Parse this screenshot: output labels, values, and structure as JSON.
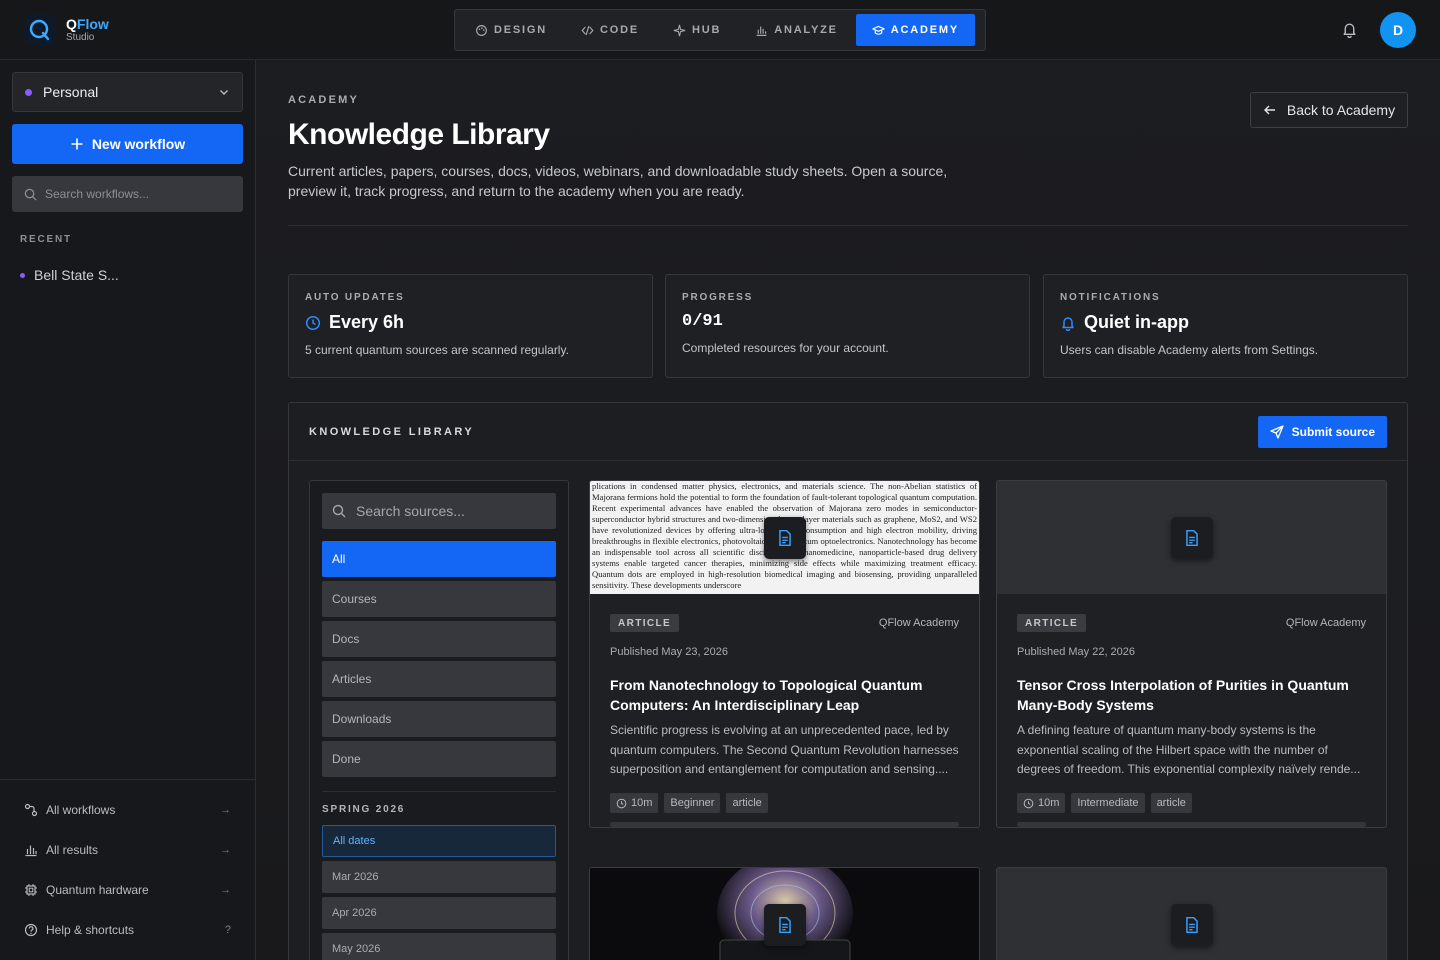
{
  "app": {
    "name_prefix": "Q",
    "name_accent": "Flow",
    "subtitle": "Studio"
  },
  "nav": {
    "tabs": [
      {
        "label": "DESIGN",
        "icon": "palette-icon",
        "active": false
      },
      {
        "label": "CODE",
        "icon": "code-icon",
        "active": false
      },
      {
        "label": "HUB",
        "icon": "hub-icon",
        "active": false
      },
      {
        "label": "ANALYZE",
        "icon": "bar-chart-icon",
        "active": false
      },
      {
        "label": "ACADEMY",
        "icon": "graduation-cap-icon",
        "active": true
      }
    ]
  },
  "user": {
    "initial": "D"
  },
  "sidebar": {
    "workspace": "Personal",
    "new_workflow": "New workflow",
    "search_placeholder": "Search workflows...",
    "recent_label": "RECENT",
    "recent": [
      "Bell State S..."
    ],
    "footer": [
      {
        "label": "All workflows",
        "icon": "workflow-icon",
        "hint": "→"
      },
      {
        "label": "All results",
        "icon": "bar-chart-icon",
        "hint": "→"
      },
      {
        "label": "Quantum hardware",
        "icon": "chip-icon",
        "hint": "→"
      },
      {
        "label": "Help & shortcuts",
        "icon": "help-icon",
        "hint": "?"
      }
    ]
  },
  "header": {
    "eyebrow": "ACADEMY",
    "title": "Knowledge Library",
    "description": "Current articles, papers, courses, docs, videos, webinars, and downloadable study sheets. Open a source, preview it, track progress, and return to the academy when you are ready.",
    "back_button": "Back to Academy"
  },
  "stats": [
    {
      "label": "AUTO UPDATES",
      "value": "Every 6h",
      "icon": "clock-icon",
      "sub": "5 current quantum sources are scanned regularly."
    },
    {
      "label": "PROGRESS",
      "value": "0/91",
      "icon": "",
      "sub": "Completed resources for your account."
    },
    {
      "label": "NOTIFICATIONS",
      "value": "Quiet in-app",
      "icon": "bell-icon",
      "sub": "Users can disable Academy alerts from Settings."
    }
  ],
  "library": {
    "label": "KNOWLEDGE LIBRARY",
    "submit": "Submit source",
    "search_placeholder": "Search sources...",
    "filters": [
      {
        "label": "All",
        "active": true
      },
      {
        "label": "Courses",
        "active": false
      },
      {
        "label": "Docs",
        "active": false
      },
      {
        "label": "Articles",
        "active": false
      },
      {
        "label": "Downloads",
        "active": false
      },
      {
        "label": "Done",
        "active": false
      }
    ],
    "season_label": "SPRING 2026",
    "dates": [
      {
        "label": "All dates",
        "active": true
      },
      {
        "label": "Mar 2026",
        "active": false
      },
      {
        "label": "Apr 2026",
        "active": false
      },
      {
        "label": "May 2026",
        "active": false
      }
    ],
    "paper_excerpt": "plications in condensed matter physics, electronics, and materials science. The non-Abelian statistics of Majorana fermions hold the potential to form the foundation of fault-tolerant topological quantum computation. Recent experimental advances have enabled the observation of Majorana zero modes in semiconductor-superconductor hybrid structures and two-dimensional monolayer materials such as graphene, MoS2, and WS2 have revolutionized devices by offering ultra-low energy consumption and high electron mobility, driving breakthroughs in flexible electronics, photovoltaics, and quantum optoelectronics. Nanotechnology has become an indispensable tool across all scientific disciplines. In nanomedicine, nanoparticle-based drug delivery systems enable targeted cancer therapies, minimizing side effects while maximizing treatment efficacy. Quantum dots are employed in high-resolution biomedical imaging and biosensing, providing unparalleled sensitivity. These developments underscore",
    "cards": [
      {
        "type": "ARTICLE",
        "source": "QFlow Academy",
        "published": "Published May 23, 2026",
        "title": "From Nanotechnology to Topological Quantum Computers: An Interdisciplinary Leap",
        "description": "Scientific progress is evolving at an unprecedented pace, led by quantum computers. The Second Quantum Revolution harnesses superposition and entanglement for computation and sensing....",
        "duration": "10m",
        "level": "Beginner",
        "kind": "article",
        "progress": 0
      },
      {
        "type": "ARTICLE",
        "source": "QFlow Academy",
        "published": "Published May 22, 2026",
        "title": "Tensor Cross Interpolation of Purities in Quantum Many-Body Systems",
        "description": "A defining feature of quantum many-body systems is the exponential scaling of the Hilbert space with the number of degrees of freedom. This exponential complexity naïvely rende...",
        "duration": "10m",
        "level": "Intermediate",
        "kind": "article",
        "progress": 0
      }
    ]
  }
}
